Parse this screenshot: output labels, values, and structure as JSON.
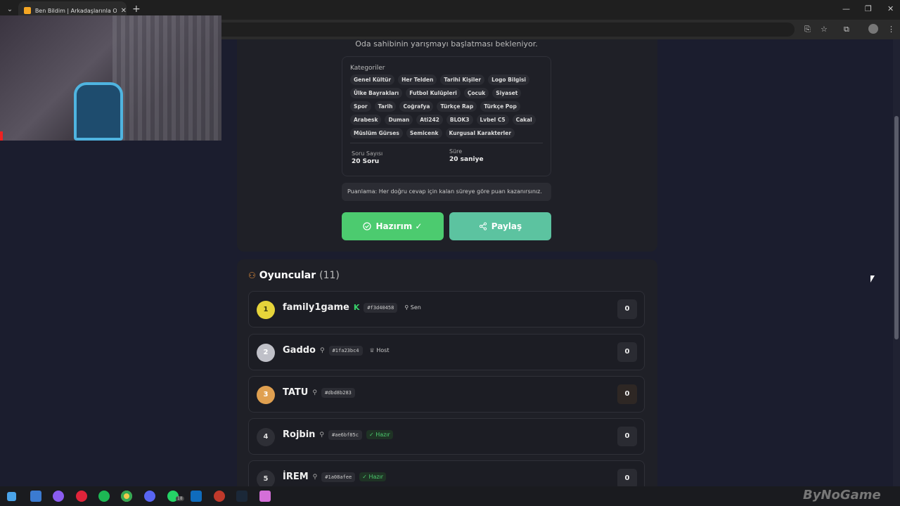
{
  "browser": {
    "tab_title": "Ben Bildim | Arkadaşlarınla Onli...",
    "new_tab_symbol": "+"
  },
  "game": {
    "waiting_text": "Oda sahibinin yarışmayı başlatması bekleniyor.",
    "categories_title": "Kategoriler",
    "categories": [
      "Genel Kültür",
      "Her Telden",
      "Tarihi Kişiler",
      "Logo Bilgisi",
      "Ülke Bayrakları",
      "Futbol Kulüpleri",
      "Çocuk",
      "Siyaset",
      "Spor",
      "Tarih",
      "Coğrafya",
      "Türkçe Rap",
      "Türkçe Pop",
      "Arabesk",
      "Duman",
      "Ati242",
      "BLOK3",
      "Lvbel C5",
      "Cakal",
      "Müslüm Gürses",
      "Semicenk",
      "Kurgusal Karakterler"
    ],
    "question_count_label": "Soru Sayısı",
    "question_count_value": "20 Soru",
    "time_label": "Süre",
    "time_value": "20 saniye",
    "scoring_text": "Puanlama: Her doğru cevap için kalan süreye göre puan kazanırsınız.",
    "ready_button": "Hazırım ✓",
    "share_button": "Paylaş"
  },
  "players": {
    "title": "Oyuncular",
    "count": "(11)",
    "list": [
      {
        "rank": "1",
        "name": "family1game",
        "id": "#f3d40458",
        "badge": "Sen",
        "score": "0"
      },
      {
        "rank": "2",
        "name": "Gaddo",
        "id": "#1fa23bc4",
        "badge": "Host",
        "score": "0"
      },
      {
        "rank": "3",
        "name": "TATU",
        "id": "#dbd8b283",
        "badge": "",
        "score": "0"
      },
      {
        "rank": "4",
        "name": "Rojbin",
        "id": "#ae6bf85c",
        "badge": "Hazır",
        "score": "0"
      },
      {
        "rank": "5",
        "name": "İREM",
        "id": "#1a08afee",
        "badge": "Hazır",
        "score": "0"
      }
    ]
  },
  "colors": {
    "accent_green": "#4ccb6f",
    "accent_teal": "#5cc3a0",
    "rank_gold": "#e6d43a",
    "rank_silver": "#bfc0c8",
    "rank_bronze": "#e0a050"
  },
  "taskbar": {
    "whatsapp_badge": "18",
    "watermark": "ByNoGame"
  }
}
